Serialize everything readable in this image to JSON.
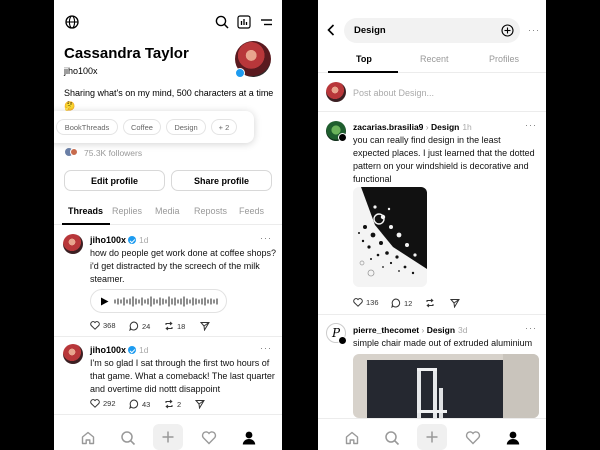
{
  "profile": {
    "name": "Cassandra Taylor",
    "handle": "jiho100x",
    "bio": "Sharing what's on my mind, 500 characters at a time",
    "bio_emoji": "🤔",
    "tags": [
      "BookThreads",
      "Coffee",
      "Design",
      "+ 2"
    ],
    "followers": "75.3K followers",
    "edit_button": "Edit profile",
    "share_button": "Share profile",
    "tabs": [
      "Threads",
      "Replies",
      "Media",
      "Reposts",
      "Feeds"
    ],
    "active_tab": "Threads"
  },
  "profile_posts": [
    {
      "user": "jiho100x",
      "time": "1d",
      "text": "how do people get work done at coffee shops? i'd get distracted by the screech of the milk steamer.",
      "likes": "368",
      "replies": "24",
      "reposts": "18"
    },
    {
      "user": "jiho100x",
      "time": "1d",
      "text": "I'm so glad I sat through the first two hours of that game. What a comeback! The last quarter and overtime did nottt disappoint",
      "likes": "292",
      "replies": "43",
      "reposts": "2"
    }
  ],
  "search": {
    "query": "Design",
    "tabs": [
      "Top",
      "Recent",
      "Profiles"
    ],
    "active_tab": "Top",
    "compose_placeholder": "Post about Design..."
  },
  "feed_posts": [
    {
      "user": "zacarias.brasilia9",
      "topic": "Design",
      "time": "1h",
      "text": "you can really find design in the least expected places. I just learned that the dotted pattern on your windshield is decorative and functional",
      "likes": "136",
      "replies": "12"
    },
    {
      "user": "pierre_thecomet",
      "topic": "Design",
      "time": "3d",
      "text": "simple chair made out of extruded aluminium"
    }
  ],
  "colors": {
    "verified": "#1d9bf0",
    "text": "#000000",
    "muted": "#999999",
    "background": "#ffffff"
  }
}
